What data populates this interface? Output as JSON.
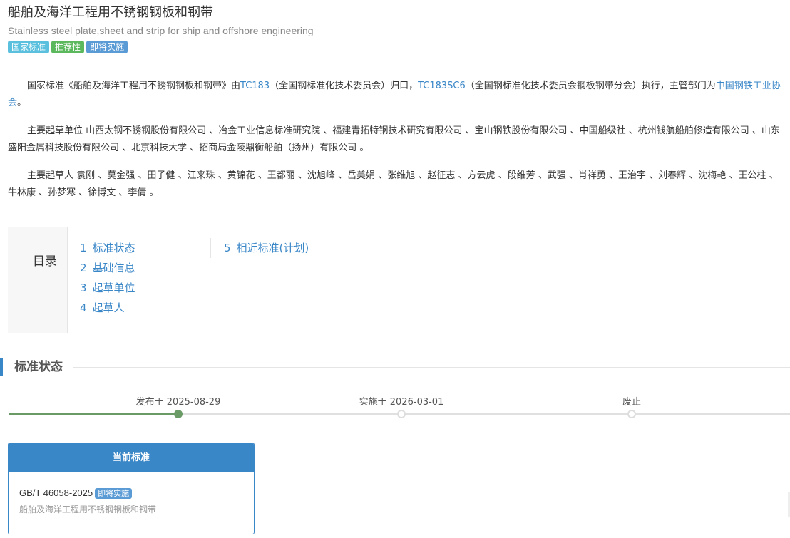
{
  "header": {
    "title": "船舶及海洋工程用不锈钢钢板和钢带",
    "subtitle": "Stainless steel plate,sheet and strip for ship and offshore engineering",
    "badges": [
      "国家标准",
      "推荐性",
      "即将实施"
    ]
  },
  "intro": {
    "p1": {
      "t1": "国家标准《船舶及海洋工程用不锈钢钢板和钢带》由",
      "tc": "TC183",
      "t2": "（全国钢标准化技术委员会）归口，",
      "sc": "TC183SC6",
      "t3": "（全国钢标准化技术委员会钢板钢带分会）执行，主管部门为",
      "dept": "中国钢铁工业协会",
      "t4": "。"
    },
    "p2": "主要起草单位 山西太钢不锈钢股份有限公司 、冶金工业信息标准研究院 、福建青拓特钢技术研究有限公司 、宝山钢铁股份有限公司 、中国船级社 、杭州钱航船舶修造有限公司 、山东盛阳金属科技股份有限公司 、北京科技大学 、招商局金陵鼎衡船舶（扬州）有限公司 。",
    "p3": "主要起草人 袁刚 、莫金强 、田子健 、江来珠 、黄锦花 、王都丽 、沈旭峰 、岳美娟 、张维旭 、赵征志 、方云虎 、段维芳 、武强 、肖祥勇 、王治宇 、刘春辉 、沈梅艳 、王公柱 、牛林康 、孙梦寒 、徐博文 、李倩 。"
  },
  "toc": {
    "heading": "目录",
    "items": [
      {
        "num": "1",
        "label": "标准状态"
      },
      {
        "num": "2",
        "label": "基础信息"
      },
      {
        "num": "3",
        "label": "起草单位"
      },
      {
        "num": "4",
        "label": "起草人"
      },
      {
        "num": "5",
        "label": "相近标准(计划)"
      }
    ]
  },
  "status_section": {
    "title": "标准状态",
    "timeline": [
      {
        "label": "发布于 2025-08-29",
        "state": "done"
      },
      {
        "label": "实施于 2026-03-01",
        "state": "pending"
      },
      {
        "label": "废止",
        "state": "pending"
      }
    ]
  },
  "current_card": {
    "header": "当前标准",
    "code": "GB/T 46058-2025",
    "badge": "即将实施",
    "name": "船舶及海洋工程用不锈钢钢板和钢带"
  },
  "colors": {
    "link": "#3a87c8",
    "badge_national": "#5bc0de",
    "badge_recommend": "#5cb85c",
    "badge_upcoming": "#5b9bd5",
    "timeline_done": "#6a9a66"
  }
}
